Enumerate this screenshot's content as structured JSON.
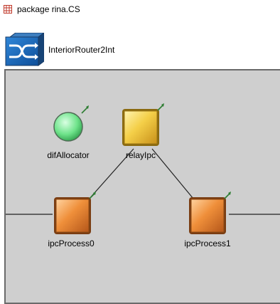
{
  "header": {
    "package_label": "package rina.CS",
    "package_icon": "package-grid-icon",
    "module_icon": "router-switch-icon",
    "module_name": "InteriorRouter2Int"
  },
  "network": {
    "nodes": [
      {
        "id": "difAllocator",
        "label": "difAllocator",
        "shape": "circle",
        "color": "#6ee38a"
      },
      {
        "id": "relayIpc",
        "label": "relayIpc",
        "shape": "square",
        "color": "#f0c640"
      },
      {
        "id": "ipcProcess0",
        "label": "ipcProcess0",
        "shape": "square",
        "color": "#ee8a36"
      },
      {
        "id": "ipcProcess1",
        "label": "ipcProcess1",
        "shape": "square",
        "color": "#ee8a36"
      }
    ],
    "connections": [
      {
        "from": "relayIpc",
        "to": "ipcProcess0"
      },
      {
        "from": "relayIpc",
        "to": "ipcProcess1"
      }
    ]
  }
}
